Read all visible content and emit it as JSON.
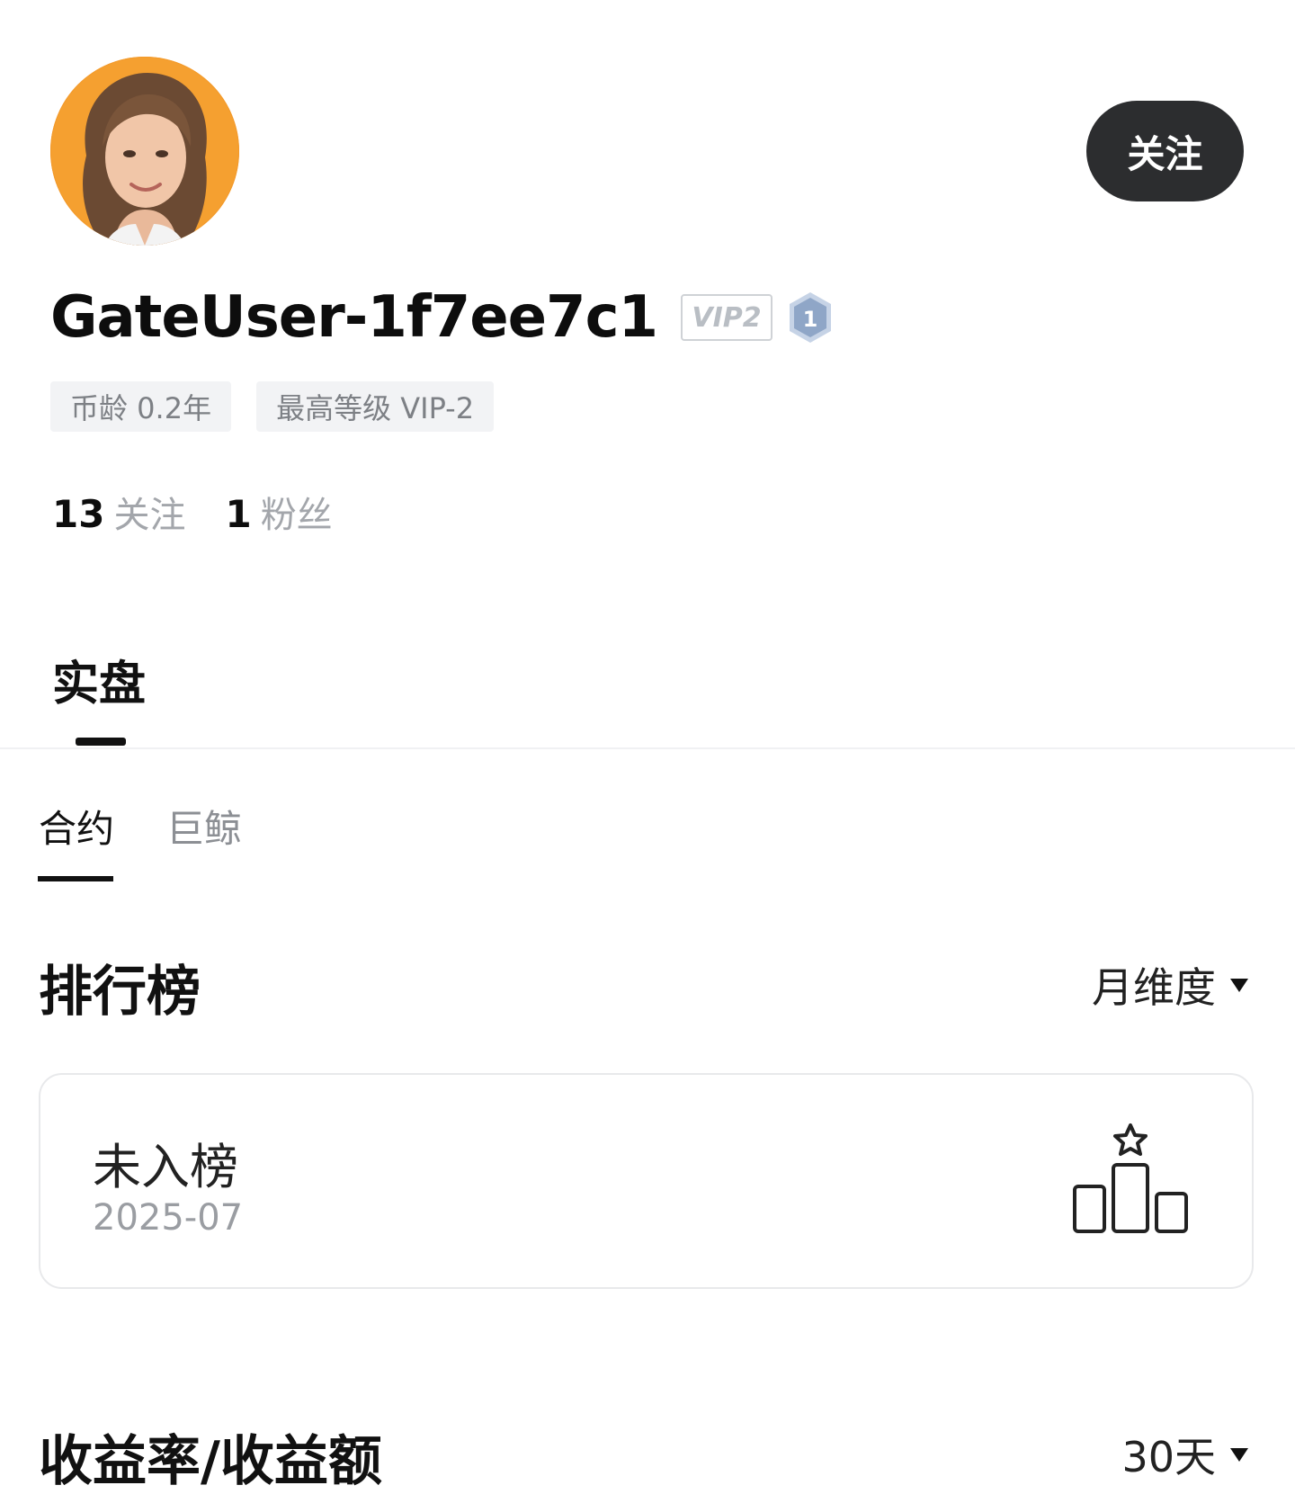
{
  "profile": {
    "follow_label": "关注",
    "username": "GateUser-1f7ee7c1",
    "vip_badge": "VIP2",
    "level_badge": "1",
    "tags": [
      "币龄 0.2年",
      "最高等级 VIP-2"
    ],
    "stats": {
      "following_count": "13",
      "following_label": "关注",
      "followers_count": "1",
      "followers_label": "粉丝"
    },
    "colors": {
      "avatar_bg": "#f39a2b",
      "follow_button_bg": "#2c2d2f",
      "level_badge": "#8fa6c7"
    }
  },
  "main_tab": {
    "label": "实盘"
  },
  "sub_tabs": [
    {
      "label": "合约",
      "active": true
    },
    {
      "label": "巨鲸",
      "active": false
    }
  ],
  "leaderboard": {
    "title": "排行榜",
    "period_label": "月维度",
    "status": "未入榜",
    "date": "2025-07",
    "icon": "podium-icon"
  },
  "profit": {
    "title": "收益率/收益额",
    "range_label": "30天"
  }
}
